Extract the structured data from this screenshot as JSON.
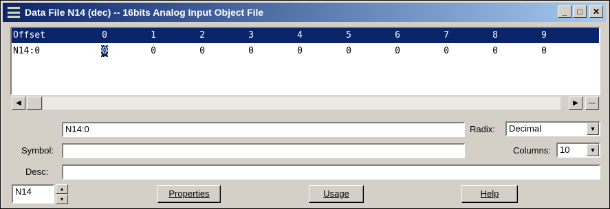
{
  "window": {
    "title": "Data File N14 (dec)  --  16bits Analog Input Object File"
  },
  "grid": {
    "columns": [
      "Offset",
      "0",
      "1",
      "2",
      "3",
      "4",
      "5",
      "6",
      "7",
      "8",
      "9"
    ],
    "rows": [
      {
        "offset": "N14:0",
        "values": [
          "0",
          "0",
          "0",
          "0",
          "0",
          "0",
          "0",
          "0",
          "0",
          "0"
        ]
      }
    ],
    "selected_cell": "N14:0"
  },
  "address_field": {
    "value": "N14:0"
  },
  "symbol": {
    "label": "Symbol:",
    "value": ""
  },
  "desc": {
    "label": "Desc:",
    "value": ""
  },
  "radix": {
    "label": "Radix:",
    "value": "Decimal"
  },
  "columns_setting": {
    "label": "Columns:",
    "value": "10"
  },
  "file_spinner": {
    "value": "N14"
  },
  "buttons": {
    "properties": "Properties",
    "usage": "Usage",
    "help": "Help"
  },
  "icons": [
    "minimize-icon",
    "restore-icon",
    "close-icon",
    "scroll-left-icon",
    "scroll-right-icon",
    "dropdown-arrow-icon",
    "spin-up-icon",
    "spin-down-icon"
  ]
}
